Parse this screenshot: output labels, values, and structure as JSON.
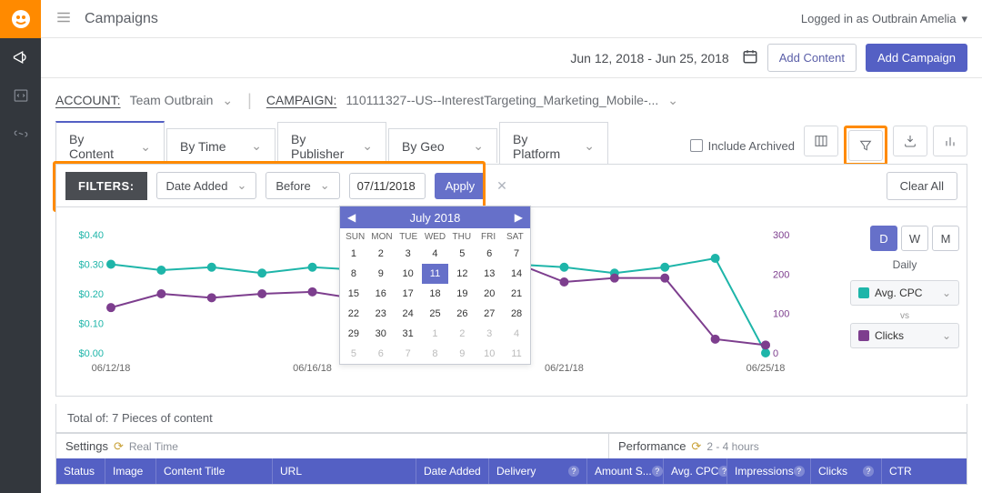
{
  "header": {
    "page_title": "Campaigns",
    "user_label": "Logged in as Outbrain Amelia"
  },
  "actionbar": {
    "date_range": "Jun 12, 2018 - Jun 25, 2018",
    "add_content": "Add Content",
    "add_campaign": "Add Campaign"
  },
  "breadcrumb": {
    "account_label": "ACCOUNT:",
    "account_val": "Team Outbrain",
    "campaign_label": "CAMPAIGN:",
    "campaign_val": "110111327--US--InterestTargeting_Marketing_Mobile-..."
  },
  "tabs": {
    "items": [
      "By Content",
      "By Time",
      "By Publisher",
      "By Geo",
      "By Platform"
    ],
    "include_archived": "Include Archived"
  },
  "filters": {
    "label": "FILTERS:",
    "field": "Date Added",
    "op": "Before",
    "value": "07/11/2018",
    "apply": "Apply",
    "clear_all": "Clear All"
  },
  "calendar": {
    "title": "July 2018",
    "dow": [
      "SUN",
      "MON",
      "TUE",
      "WED",
      "THU",
      "FRI",
      "SAT"
    ],
    "weeks": [
      [
        {
          "d": 1
        },
        {
          "d": 2
        },
        {
          "d": 3
        },
        {
          "d": 4
        },
        {
          "d": 5
        },
        {
          "d": 6
        },
        {
          "d": 7
        }
      ],
      [
        {
          "d": 8
        },
        {
          "d": 9
        },
        {
          "d": 10
        },
        {
          "d": 11,
          "sel": true
        },
        {
          "d": 12
        },
        {
          "d": 13
        },
        {
          "d": 14
        }
      ],
      [
        {
          "d": 15
        },
        {
          "d": 16
        },
        {
          "d": 17
        },
        {
          "d": 18
        },
        {
          "d": 19
        },
        {
          "d": 20
        },
        {
          "d": 21
        }
      ],
      [
        {
          "d": 22
        },
        {
          "d": 23
        },
        {
          "d": 24
        },
        {
          "d": 25
        },
        {
          "d": 26
        },
        {
          "d": 27
        },
        {
          "d": 28
        }
      ],
      [
        {
          "d": 29
        },
        {
          "d": 30
        },
        {
          "d": 31
        },
        {
          "d": 1,
          "muted": true
        },
        {
          "d": 2,
          "muted": true
        },
        {
          "d": 3,
          "muted": true
        },
        {
          "d": 4,
          "muted": true
        }
      ],
      [
        {
          "d": 5,
          "muted": true
        },
        {
          "d": 6,
          "muted": true
        },
        {
          "d": 7,
          "muted": true
        },
        {
          "d": 8,
          "muted": true
        },
        {
          "d": 9,
          "muted": true
        },
        {
          "d": 10,
          "muted": true
        },
        {
          "d": 11,
          "muted": true
        }
      ]
    ]
  },
  "chart_data": {
    "type": "line",
    "x": [
      "06/12/18",
      "06/13/18",
      "06/14/18",
      "06/15/18",
      "06/16/18",
      "06/17/18",
      "06/18/18",
      "06/19/18",
      "06/20/18",
      "06/21/18",
      "06/22/18",
      "06/23/18",
      "06/24/18",
      "06/25/18"
    ],
    "x_tick_labels": [
      "06/12/18",
      "06/16/18",
      "06/21/18",
      "06/25/18"
    ],
    "series": [
      {
        "name": "Avg. CPC",
        "axis": "left",
        "color": "#1eb5a9",
        "values": [
          0.3,
          0.28,
          0.29,
          0.27,
          0.29,
          0.28,
          0.27,
          0.29,
          0.3,
          0.29,
          0.27,
          0.29,
          0.32,
          0.0
        ]
      },
      {
        "name": "Clicks",
        "axis": "right",
        "color": "#7d3e8e",
        "values": [
          115,
          150,
          140,
          150,
          155,
          135,
          150,
          265,
          230,
          180,
          190,
          190,
          35,
          20
        ]
      }
    ],
    "yleft": {
      "ticks": [
        0.0,
        0.1,
        0.2,
        0.3,
        0.4
      ],
      "labels": [
        "$0.00",
        "$0.10",
        "$0.20",
        "$0.30",
        "$0.40"
      ]
    },
    "yright": {
      "ticks": [
        0,
        100,
        200,
        300
      ]
    },
    "period_toggle": [
      "D",
      "W",
      "M"
    ],
    "period_active": "D",
    "period_label": "Daily",
    "metric_a": "Avg. CPC",
    "metric_b": "Clicks",
    "vs": "vs"
  },
  "totals": {
    "text": "Total of: 7 Pieces of content"
  },
  "table": {
    "section_a": {
      "label": "Settings",
      "timing": "Real Time"
    },
    "section_b": {
      "label": "Performance",
      "timing": "2 - 4 hours"
    },
    "columns_a": [
      "Status",
      "Image",
      "Content Title",
      "URL",
      "Date Added",
      "Delivery"
    ],
    "columns_b": [
      "Amount S...",
      "Avg. CPC",
      "Impressions",
      "Clicks",
      "CTR"
    ]
  }
}
